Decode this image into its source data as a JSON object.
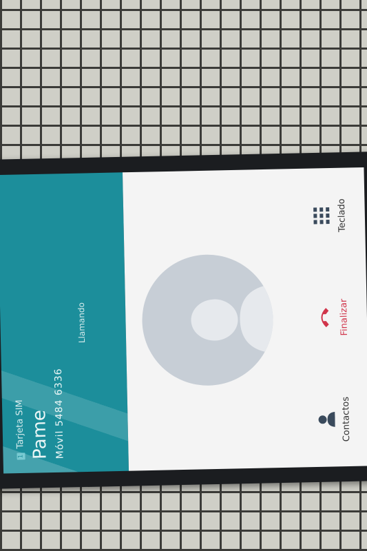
{
  "call": {
    "sim_label": "Tarjeta SIM",
    "sim_index": "1",
    "contact_name": "Pame",
    "number_line": "Móvil  5484 6336",
    "status": "Llamando"
  },
  "actions": {
    "contacts": {
      "label": "Contactos",
      "icon": "person-icon"
    },
    "end": {
      "label": "Finalizar",
      "icon": "end-call-icon",
      "color": "#d0344a"
    },
    "keypad": {
      "label": "Teclado",
      "icon": "keypad-icon"
    }
  },
  "colors": {
    "header": "#1c8e9b",
    "body": "#f4f4f4",
    "avatar": "#c7ced6"
  }
}
